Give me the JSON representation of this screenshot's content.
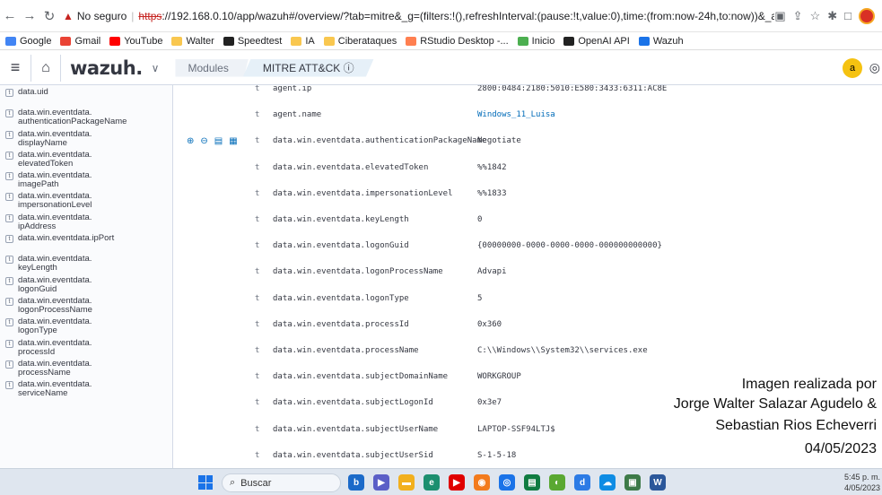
{
  "browser": {
    "security_label": "No seguro",
    "url_protocol": "https",
    "url_rest": "://192.168.0.10/app/wazuh#/overview/?tab=mitre&_g=(filters:!(),refreshInterval:(pause:!t,value:0),time:(from:now-24h,to:now))&_a=(column..."
  },
  "bookmarks": [
    {
      "label": "Google",
      "color": "#4285f4"
    },
    {
      "label": "Gmail",
      "color": "#ea4335"
    },
    {
      "label": "YouTube",
      "color": "#ff0000"
    },
    {
      "label": "Walter",
      "color": "#f9c74f"
    },
    {
      "label": "Speedtest",
      "color": "#222222"
    },
    {
      "label": "IA",
      "color": "#f9c74f"
    },
    {
      "label": "Ciberataques",
      "color": "#f9c74f"
    },
    {
      "label": "RStudio Desktop -...",
      "color": "#ff7f50"
    },
    {
      "label": "Inicio",
      "color": "#4caf50"
    },
    {
      "label": "OpenAI API",
      "color": "#222222"
    },
    {
      "label": "Wazuh",
      "color": "#1a73e8"
    }
  ],
  "app": {
    "logo": "wazuh.",
    "breadcrumb_modules": "Modules",
    "breadcrumb_current": "MITRE ATT&CK ⓘ",
    "user_initial": "a"
  },
  "sidebar_fields": [
    "data.uid",
    "data.win.eventdata.\nauthenticationPackageName",
    "data.win.eventdata.\ndisplayName",
    "data.win.eventdata.\nelevatedToken",
    "data.win.eventdata.\nimagePath",
    "data.win.eventdata.\nimpersonationLevel",
    "data.win.eventdata.\nipAddress",
    "data.win.eventdata.ipPort",
    "data.win.eventdata.\nkeyLength",
    "data.win.eventdata.\nlogonGuid",
    "data.win.eventdata.\nlogonProcessName",
    "data.win.eventdata.\nlogonType",
    "data.win.eventdata.\nprocessId",
    "data.win.eventdata.\nprocessName",
    "data.win.eventdata.\nserviceName"
  ],
  "rows": [
    {
      "key": "agent.ip",
      "value": "2800:0484:2180:5010:E580:3433:6311:AC8E",
      "link": false
    },
    {
      "key": "agent.name",
      "value": "Windows_11_Luisa",
      "link": true
    },
    {
      "key": "data.win.eventdata.authenticationPackageName",
      "value": "Negotiate",
      "link": false
    },
    {
      "key": "data.win.eventdata.elevatedToken",
      "value": "%%1842",
      "link": false
    },
    {
      "key": "data.win.eventdata.impersonationLevel",
      "value": "%%1833",
      "link": false
    },
    {
      "key": "data.win.eventdata.keyLength",
      "value": "0",
      "link": false
    },
    {
      "key": "data.win.eventdata.logonGuid",
      "value": "{00000000-0000-0000-0000-000000000000}",
      "link": false
    },
    {
      "key": "data.win.eventdata.logonProcessName",
      "value": "Advapi",
      "link": false
    },
    {
      "key": "data.win.eventdata.logonType",
      "value": "5",
      "link": false
    },
    {
      "key": "data.win.eventdata.processId",
      "value": "0x360",
      "link": false
    },
    {
      "key": "data.win.eventdata.processName",
      "value": "C:\\\\Windows\\\\System32\\\\services.exe",
      "link": false
    },
    {
      "key": "data.win.eventdata.subjectDomainName",
      "value": "WORKGROUP",
      "link": false
    },
    {
      "key": "data.win.eventdata.subjectLogonId",
      "value": "0x3e7",
      "link": false
    },
    {
      "key": "data.win.eventdata.subjectUserName",
      "value": "LAPTOP-SSF94LTJ$",
      "link": false
    },
    {
      "key": "data.win.eventdata.subjectUserSid",
      "value": "S-1-5-18",
      "link": false
    }
  ],
  "credits": [
    "Imagen realizada por",
    "Jorge Walter Salazar Agudelo &",
    "Sebastian Rios Echeverri",
    "04/05/2023"
  ],
  "taskbar": {
    "search_label": "Buscar",
    "time": "5:45 p. m.",
    "date": "4/05/2023"
  }
}
